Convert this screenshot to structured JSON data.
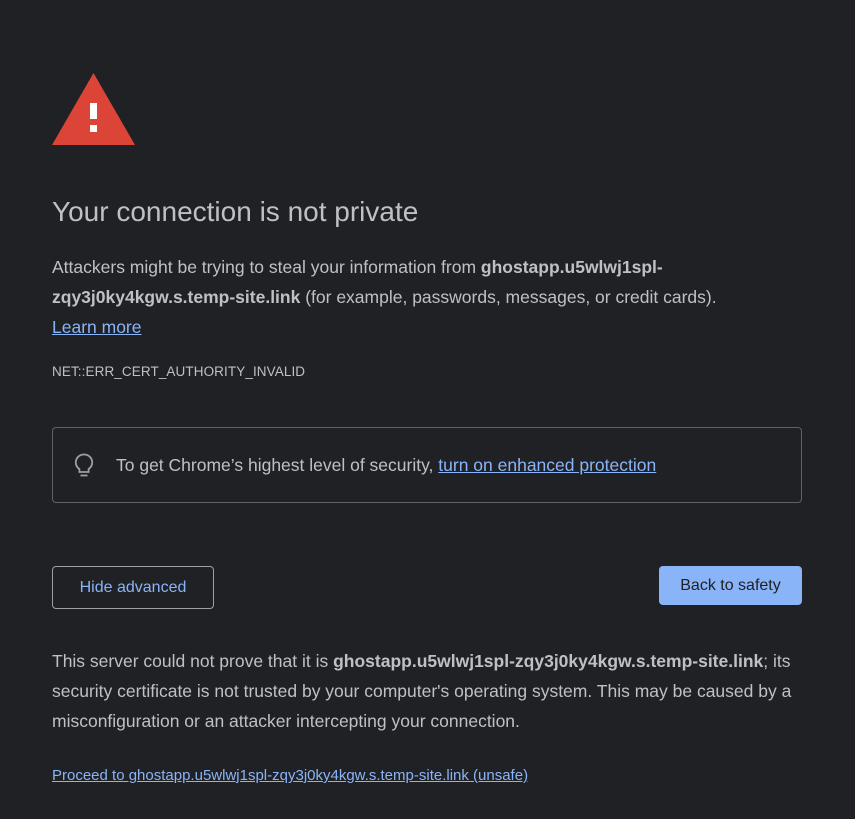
{
  "page": {
    "title": "Your connection is not private",
    "intro_prefix": "Attackers might be trying to steal your information from ",
    "host": "ghostapp.u5wlwj1spl-zqy3j0ky4kgw.s.temp-site.link",
    "intro_suffix": " (for example, passwords, messages, or credit cards).",
    "learn_more": "Learn more",
    "error_code": "NET::ERR_CERT_AUTHORITY_INVALID"
  },
  "enhanced": {
    "text": "To get Chrome’s highest level of security, ",
    "link": "turn on enhanced protection",
    "icon": "lightbulb-icon"
  },
  "buttons": {
    "hide_advanced": "Hide advanced",
    "back_to_safety": "Back to safety"
  },
  "details": {
    "prefix": "This server could not prove that it is ",
    "host": "ghostapp.u5wlwj1spl-zqy3j0ky4kgw.s.temp-site.link",
    "suffix": "; its security certificate is not trusted by your computer's operating system. This may be caused by a misconfiguration or an attacker intercepting your connection.",
    "proceed_link": "Proceed to ghostapp.u5wlwj1spl-zqy3j0ky4kgw.s.temp-site.link (unsafe)"
  },
  "colors": {
    "background": "#202124",
    "text": "#bdc1c6",
    "link": "#8ab4f8",
    "warning_red": "#db4437",
    "primary_button": "#8ab4f8"
  },
  "icons": {
    "warning": "warning-triangle-icon"
  }
}
